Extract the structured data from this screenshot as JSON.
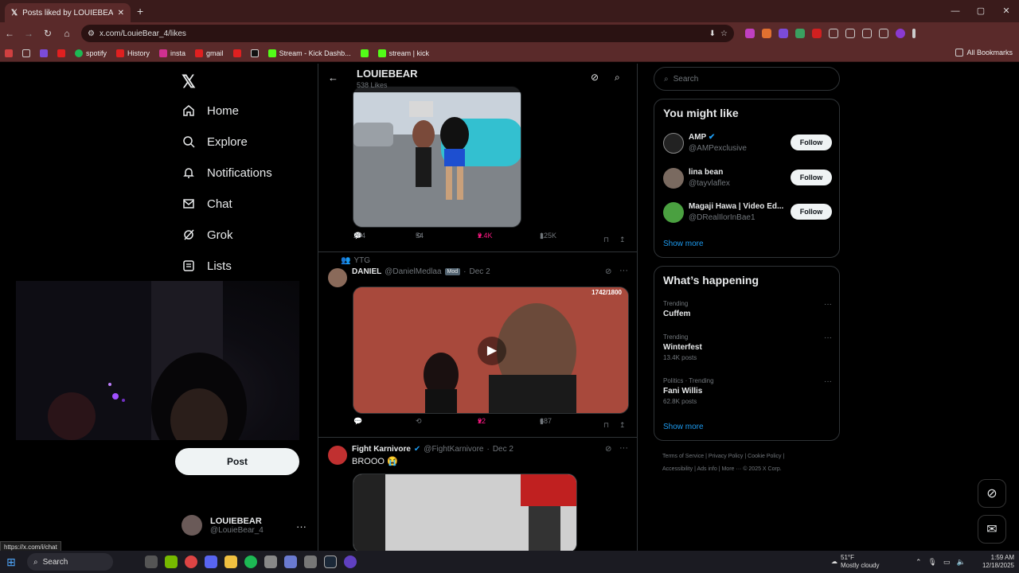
{
  "browser": {
    "tab_title": "Posts liked by LOUIEBEAR (",
    "url": "x.com/LouieBear_4/likes",
    "bookmarks": [
      "spotify",
      "History",
      "insta",
      "gmail",
      "Stream - Kick Dashb...",
      "stream | kick"
    ],
    "all_bookmarks": "All Bookmarks",
    "status_url": "https://x.com/i/chat"
  },
  "nav": {
    "items": [
      {
        "label": "Home",
        "icon": "home-icon"
      },
      {
        "label": "Explore",
        "icon": "search-icon"
      },
      {
        "label": "Notifications",
        "icon": "bell-icon"
      },
      {
        "label": "Chat",
        "icon": "mail-icon"
      },
      {
        "label": "Grok",
        "icon": "grok-icon"
      },
      {
        "label": "Lists",
        "icon": "list-icon"
      }
    ],
    "post_label": "Post",
    "account_name": "LOUIEBEAR",
    "account_handle": "@LouieBear_4"
  },
  "feed": {
    "title": "LOUIEBEAR",
    "subtitle": "538 Likes",
    "post1": {
      "replies": "204",
      "reposts": "54",
      "likes": "2.4K",
      "views": "125K"
    },
    "post2": {
      "context": "YTG",
      "name": "DANIEL",
      "handle": "@DanielMedlaa",
      "badge": "Mod",
      "date": "Dec 2",
      "counter": "1742/1800",
      "replies": "",
      "reposts": "",
      "likes": "22",
      "views": "687"
    },
    "post3": {
      "name": "Fight Karnivore",
      "handle": "@FightKarnivore",
      "date": "Dec 2",
      "text": "BROOO 😭"
    }
  },
  "sidebar": {
    "search_placeholder": "Search",
    "you_might_like": "You might like",
    "suggestions": [
      {
        "name": "AMP",
        "handle": "@AMPexclusive",
        "button": "Follow"
      },
      {
        "name": "lina bean",
        "handle": "@tayvlaflex",
        "button": "Follow"
      },
      {
        "name": "Magaji Hawa | Video Ed...",
        "handle": "@DRealIlorInBae1",
        "button": "Follow"
      }
    ],
    "show_more": "Show more",
    "whats_happening": "What’s happening",
    "trends": [
      {
        "category": "Trending",
        "name": "Cuffem",
        "posts": ""
      },
      {
        "category": "Trending",
        "name": "Winterfest",
        "posts": "13.4K posts"
      },
      {
        "category": "Politics · Trending",
        "name": "Fani Willis",
        "posts": "62.8K posts"
      }
    ],
    "footer": [
      "Terms of Service",
      "Privacy Policy",
      "Cookie Policy",
      "Accessibility",
      "Ads info",
      "More ···",
      "© 2025 X Corp."
    ]
  },
  "taskbar": {
    "search": "Search",
    "temp": "51°F",
    "weather": "Mostly cloudy",
    "time": "1:59 AM",
    "date": "12/18/2025"
  }
}
